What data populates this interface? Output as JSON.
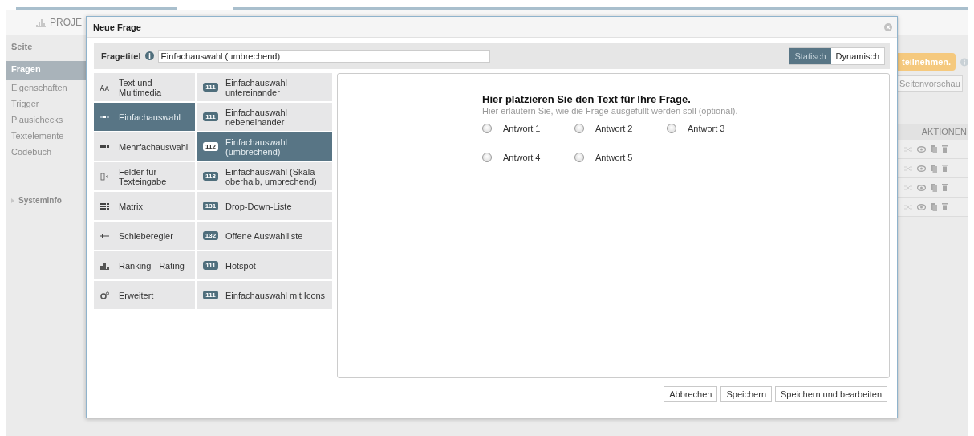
{
  "app": {
    "project_label": "PROJE",
    "sidebar": {
      "header": "Seite",
      "items": [
        {
          "label": "Fragen",
          "selected": true
        },
        {
          "label": "Eigenschaften",
          "selected": false
        },
        {
          "label": "Trigger",
          "selected": false
        },
        {
          "label": "Plausichecks",
          "selected": false
        },
        {
          "label": "Textelemente",
          "selected": false
        },
        {
          "label": "Codebuch",
          "selected": false
        }
      ],
      "footer": "Systeminfo"
    },
    "right_panel": {
      "badge": "teilnehmen.",
      "preview_button": "Seitenvorschau",
      "column_header": "AKTIONEN"
    }
  },
  "dialog": {
    "title": "Neue Frage",
    "title_field": {
      "label": "Fragetitel",
      "value": "Einfachauswahl (umbrechend)"
    },
    "mode_toggle": [
      {
        "label": "Statisch",
        "selected": true
      },
      {
        "label": "Dynamisch",
        "selected": false
      }
    ],
    "categories": [
      {
        "kind": "text",
        "label": "Text und Multimedia",
        "selected": false
      },
      {
        "kind": "single",
        "label": "Einfachauswahl",
        "selected": true
      },
      {
        "kind": "multi",
        "label": "Mehrfachauswahl",
        "selected": false
      },
      {
        "kind": "input",
        "label": "Felder für Texteingabe",
        "selected": false
      },
      {
        "kind": "matrix",
        "label": "Matrix",
        "selected": false
      },
      {
        "kind": "slider",
        "label": "Schieberegler",
        "selected": false
      },
      {
        "kind": "ranking",
        "label": "Ranking - Rating",
        "selected": false
      },
      {
        "kind": "advanced",
        "label": "Erweitert",
        "selected": false
      }
    ],
    "types": [
      {
        "code": "111",
        "label": "Einfachauswahl untereinander",
        "selected": false
      },
      {
        "code": "111",
        "label": "Einfachauswahl nebeneinander",
        "selected": false
      },
      {
        "code": "112",
        "label": "Einfachauswahl (umbrechend)",
        "selected": true
      },
      {
        "code": "113",
        "label": "Einfachauswahl (Skala oberhalb, umbrechend)",
        "selected": false
      },
      {
        "code": "131",
        "label": "Drop-Down-Liste",
        "selected": false
      },
      {
        "code": "132",
        "label": "Offene Auswahlliste",
        "selected": false
      },
      {
        "code": "111",
        "label": "Hotspot",
        "selected": false
      },
      {
        "code": "111",
        "label": "Einfachauswahl mit Icons",
        "selected": false
      }
    ],
    "preview": {
      "question": "Hier platzieren Sie den Text für Ihre Frage.",
      "hint": "Hier erläutern Sie, wie die Frage ausgefüllt werden soll (optional).",
      "answers": [
        {
          "label": "Antwort 1",
          "selected": false
        },
        {
          "label": "Antwort 2",
          "selected": false
        },
        {
          "label": "Antwort 3",
          "selected": false
        },
        {
          "label": "Antwort 4",
          "selected": false
        },
        {
          "label": "Antwort 5",
          "selected": false
        }
      ]
    },
    "buttons": [
      "Abbrechen",
      "Speichern",
      "Speichern und bearbeiten"
    ]
  }
}
